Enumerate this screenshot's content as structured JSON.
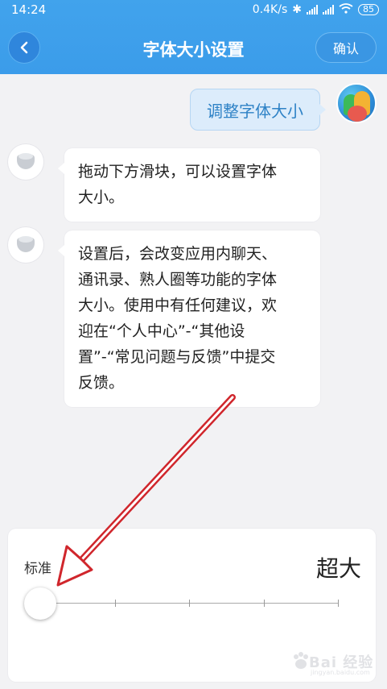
{
  "status_bar": {
    "time": "14:24",
    "network_speed": "0.4K/s",
    "battery": "85",
    "icons": [
      "bluetooth-icon",
      "signal-icon",
      "signal-icon",
      "wifi-icon",
      "battery-icon"
    ]
  },
  "header": {
    "title": "字体大小设置",
    "back_icon": "chevron-left-icon",
    "confirm_label": "确认"
  },
  "messages": [
    {
      "side": "right",
      "text": "调整字体大小"
    },
    {
      "side": "left",
      "lines": [
        "拖动下方滑块，可以设置字体",
        "大小。"
      ]
    },
    {
      "side": "left",
      "lines": [
        "设置后，会改变应用内聊天、",
        "通讯录、熟人圈等功能的字体",
        "大小。使用中有任何建议，欢",
        "迎在“个人中心”-“其他设",
        "置”-“常见问题与反馈”中提交",
        "反馈。"
      ]
    }
  ],
  "font_slider": {
    "min_label": "标准",
    "max_label": "超大",
    "steps": 5,
    "value_step": 0
  },
  "watermark": {
    "text": "Bai  经验",
    "sub": "jingyan.baidu.com"
  },
  "colors": {
    "header": "#3b9cea",
    "annotation_arrow": "#d0262c",
    "bubble_right": "#dcecfb",
    "bubble_right_text": "#2e82c6"
  }
}
